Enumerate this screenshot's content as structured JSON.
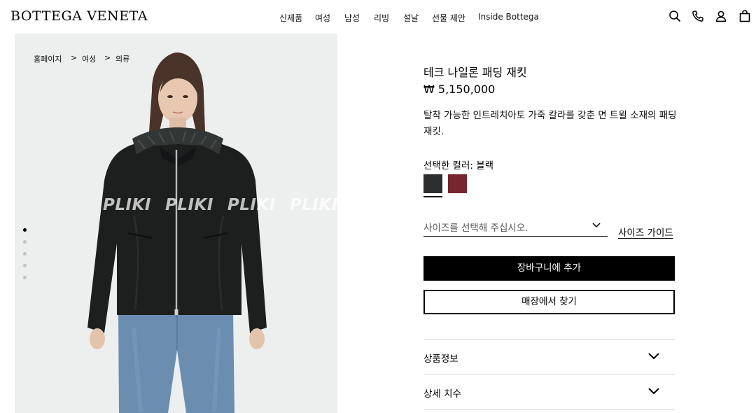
{
  "brand": {
    "logo_text": "BOTTEGA VENETA"
  },
  "nav": {
    "items": [
      "신제품",
      "여성",
      "남성",
      "리빙",
      "설날",
      "선물 제안",
      "Inside Bottega"
    ]
  },
  "header_icons": [
    "search-icon",
    "phone-icon",
    "account-icon",
    "shopping-bag-icon"
  ],
  "breadcrumb": {
    "items": [
      "홈페이지",
      "여성",
      "의류"
    ],
    "separator": ">"
  },
  "gallery": {
    "watermark": [
      "PLIKI",
      "PLIKI",
      "PLIKI",
      "PLIKI"
    ],
    "dot_count": 5,
    "active_index": 0
  },
  "product": {
    "title": "테크 나일론 패딩 재킷",
    "price": "₩ 5,150,000",
    "description": "탈착 가능한 인트레치아토 가죽 칼라를 갖춘 면 트윌 소재의 패딩 재킷.",
    "color_label": "선택한 컬러: 블랙",
    "colors": [
      {
        "name": "블랙",
        "hex": "#2d2e30",
        "selected": true
      },
      {
        "name": "레드",
        "hex": "#772630",
        "selected": false
      }
    ]
  },
  "size": {
    "placeholder": "사이즈를 선택해 주십시오.",
    "guide_label": "사이즈 가이드"
  },
  "actions": {
    "add_to_cart": "장바구니에 추가",
    "find_in_store": "매장에서 찾기"
  },
  "accordion": {
    "items": [
      "상품정보",
      "상세 치수"
    ]
  },
  "colors": {
    "accent": "#000000",
    "image_background": "#ecefee"
  }
}
